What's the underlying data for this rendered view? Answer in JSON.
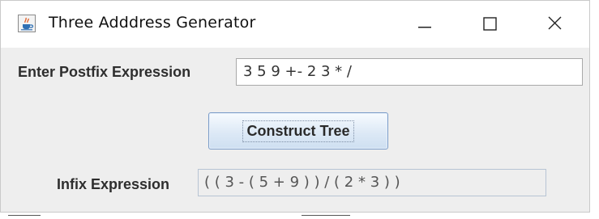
{
  "window": {
    "title": "Three Adddress Generator",
    "icons": {
      "app": "java-cup-icon",
      "minimize": "minimize-icon",
      "maximize": "maximize-icon",
      "close": "close-icon"
    }
  },
  "form": {
    "postfix_label": "Enter Postfix Expression",
    "postfix_value": "3 5 9 +- 2 3 * /",
    "construct_button_label": "Construct Tree",
    "infix_label": "Infix Expression",
    "infix_value": "( ( 3 - ( 5 + 9 ) ) / ( 2 * 3 ) )"
  },
  "colors": {
    "window_bg": "#eeeeee",
    "button_border": "#7a9cc8",
    "button_focus_dots": "#7e8fa6"
  }
}
